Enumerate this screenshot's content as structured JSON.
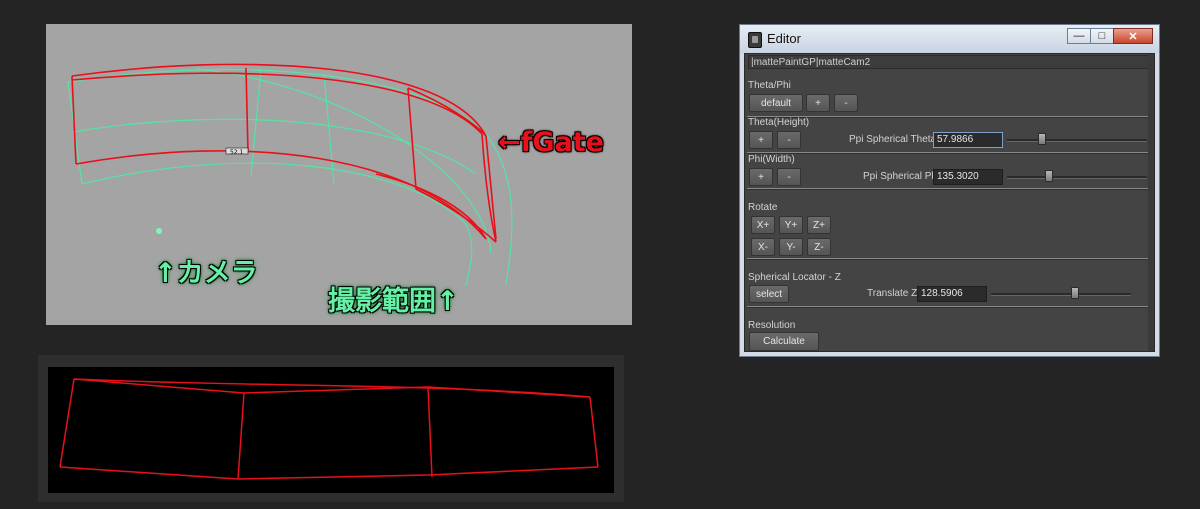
{
  "annotations": {
    "fgate": "←fGate",
    "camera": "↑カメラ",
    "shooting_range": "撮影範囲↑",
    "gate_tag": "52.1"
  },
  "editor": {
    "title": "Editor",
    "window_buttons": {
      "minimize": "—",
      "maximize": "□",
      "close": "✕"
    },
    "path": "|mattePaintGP|matteCam2",
    "theta_phi": {
      "label": "Theta/Phi",
      "default_button": "default",
      "plus_button": "+",
      "minus_button": "-"
    },
    "theta_height": {
      "label": "Theta(Height)",
      "plus_button": "+",
      "minus_button": "-",
      "field_label": "Ppi Spherical Theta",
      "value": "57.9866",
      "slider_fraction": 0.25
    },
    "phi_width": {
      "label": "Phi(Width)",
      "plus_button": "+",
      "minus_button": "-",
      "field_label": "Ppi Spherical Phi",
      "value": "135.3020",
      "slider_fraction": 0.3
    },
    "rotate": {
      "label": "Rotate",
      "buttons": [
        "X+",
        "Y+",
        "Z+",
        "X-",
        "Y-",
        "Z-"
      ]
    },
    "spherical_locator": {
      "label": "Spherical Locator - Z",
      "select_button": "select",
      "field_label": "Translate Z",
      "value": "128.5906",
      "slider_fraction": 0.6
    },
    "resolution": {
      "label": "Resolution",
      "calculate_button": "Calculate"
    }
  }
}
